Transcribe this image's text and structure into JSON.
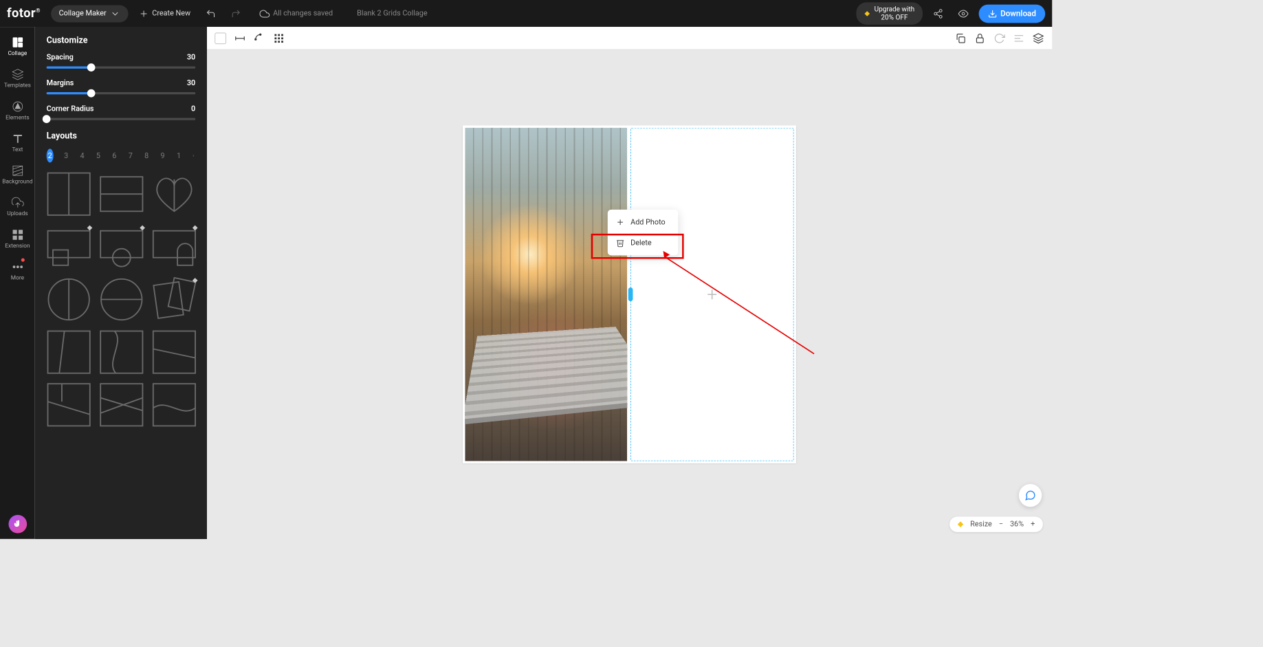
{
  "topbar": {
    "logo": "fotor",
    "mode": "Collage Maker",
    "create": "Create New",
    "status": "All changes saved",
    "doc_title": "Blank 2 Grids Collage",
    "upgrade_line1": "Upgrade with",
    "upgrade_line2": "20% OFF",
    "download": "Download"
  },
  "rail": {
    "collage": "Collage",
    "templates": "Templates",
    "elements": "Elements",
    "text": "Text",
    "background": "Background",
    "uploads": "Uploads",
    "extension": "Extension",
    "more": "More"
  },
  "panel": {
    "title": "Customize",
    "spacing_label": "Spacing",
    "spacing_val": "30",
    "margins_label": "Margins",
    "margins_val": "30",
    "radius_label": "Corner Radius",
    "radius_val": "0",
    "layouts_title": "Layouts",
    "tabs": [
      "2",
      "3",
      "4",
      "5",
      "6",
      "7",
      "8",
      "9",
      "1"
    ]
  },
  "ctx": {
    "add": "Add Photo",
    "del": "Delete"
  },
  "zoom": {
    "resize": "Resize",
    "level": "36%"
  }
}
